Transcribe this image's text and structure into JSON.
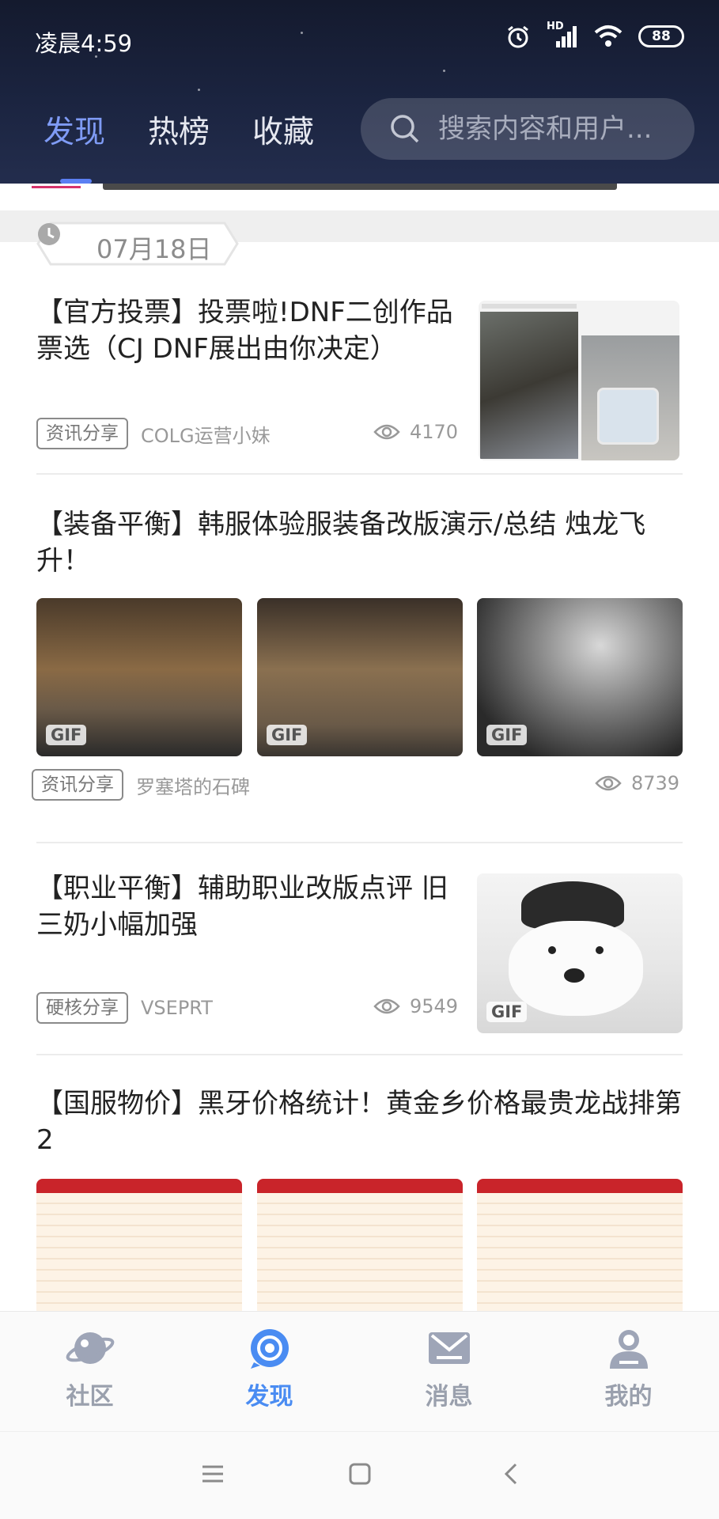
{
  "status_bar": {
    "time": "凌晨4:59",
    "battery": "88",
    "network_label": "HD"
  },
  "top_tabs": [
    {
      "label": "发现",
      "active": true
    },
    {
      "label": "热榜",
      "active": false
    },
    {
      "label": "收藏",
      "active": false
    }
  ],
  "search": {
    "placeholder": "搜索内容和用户..."
  },
  "date_header": "07月18日",
  "feed": [
    {
      "title": "【官方投票】投票啦!DNF二创作品票选（CJ DNF展出由你决定）",
      "tag": "资讯分享",
      "author": "COLG运营小妹",
      "views": "4170"
    },
    {
      "title": "【装备平衡】韩服体验服装备改版演示/总结 烛龙飞升！",
      "tag": "资讯分享",
      "author": "罗塞塔的石碑",
      "views": "8739",
      "badges": [
        "GIF",
        "GIF",
        "GIF"
      ]
    },
    {
      "title": "【职业平衡】辅助职业改版点评 旧三奶小幅加强",
      "tag": "硬核分享",
      "author": "VSEPRT",
      "views": "9549",
      "badges": [
        "GIF"
      ]
    },
    {
      "title": "【国服物价】黑牙价格统计！黄金乡价格最贵龙战排第2"
    }
  ],
  "bottom_nav": [
    {
      "label": "社区",
      "icon": "planet-icon",
      "active": false
    },
    {
      "label": "发现",
      "icon": "discover-icon",
      "active": true
    },
    {
      "label": "消息",
      "icon": "mail-icon",
      "active": false
    },
    {
      "label": "我的",
      "icon": "profile-icon",
      "active": false
    }
  ],
  "colors": {
    "accent": "#4a8cf2",
    "header_bg": "#1b2440",
    "tab_active": "#7f9bf5"
  }
}
